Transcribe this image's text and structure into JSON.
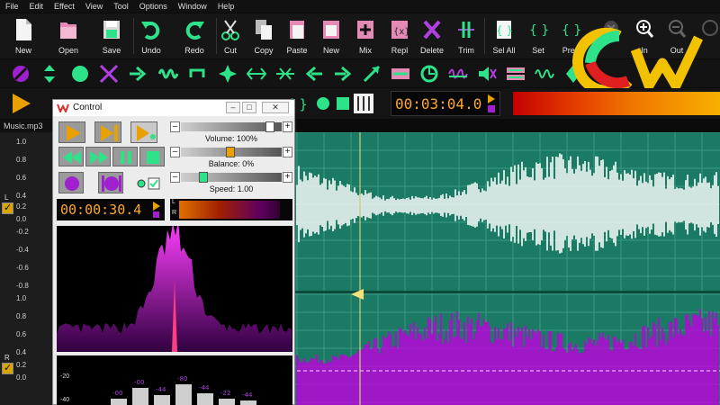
{
  "menu": [
    "File",
    "Edit",
    "Effect",
    "View",
    "Tool",
    "Options",
    "Window",
    "Help"
  ],
  "toolbar": {
    "new": "New",
    "open": "Open",
    "save": "Save",
    "undo": "Undo",
    "redo": "Redo",
    "cut": "Cut",
    "copy": "Copy",
    "paste": "Paste",
    "new2": "New",
    "mix": "Mix",
    "repl": "Repl",
    "delete": "Delete",
    "trim": "Trim",
    "sel_all": "Sel All",
    "set": "Set",
    "prev": "Prev",
    "zoom_in": "In",
    "zoom_out": "Out"
  },
  "main_time": "00:03:04.0",
  "file_tab": "Music.mp3",
  "ruler": {
    "top_ticks": [
      "1.0",
      "0.8",
      "0.6",
      "0.4",
      "0.2",
      "0.0",
      "-0.2",
      "-0.4",
      "-0.6",
      "-0.8"
    ],
    "bottom_ticks": [
      "1.0",
      "0.8",
      "0.6",
      "0.4",
      "0.2",
      "0.0"
    ],
    "left_label": "L",
    "right_label": "R"
  },
  "control": {
    "title": "Control",
    "volume": "Volume: 100%",
    "balance": "Balance: 0%",
    "speed": "Speed: 1.00",
    "time": "00:00:30.4",
    "meter_l": "L",
    "meter_r": "R",
    "bar_scale": [
      "-20",
      "-40"
    ],
    "bar_labels": [
      "-00",
      "-00",
      "-44",
      "-80",
      "-44",
      "-22",
      "-44"
    ]
  },
  "colors": {
    "accent": "#2ee28a",
    "time_text": "#ffa62b",
    "wave_bg": "#1a7a64",
    "left_wave": "#ffffff",
    "right_wave": "#c000e0"
  }
}
